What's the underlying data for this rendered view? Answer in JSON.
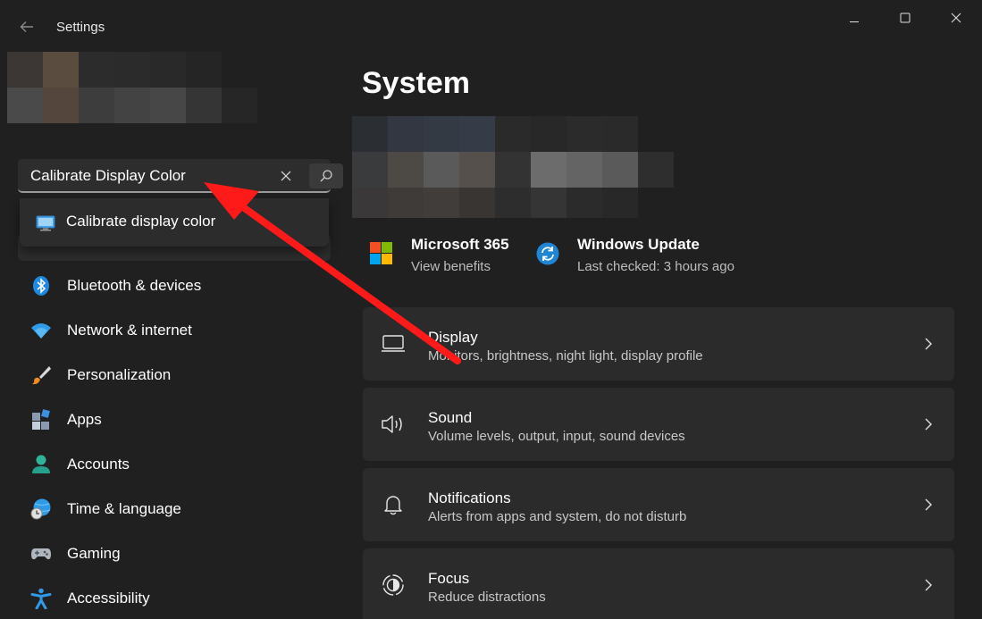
{
  "window": {
    "title": "Settings"
  },
  "search": {
    "value": "Calibrate Display Color",
    "suggestion": "Calibrate display color"
  },
  "sidebar": {
    "items": [
      {
        "label": "Bluetooth & devices",
        "icon": "bluetooth-icon"
      },
      {
        "label": "Network & internet",
        "icon": "wifi-icon"
      },
      {
        "label": "Personalization",
        "icon": "brush-icon"
      },
      {
        "label": "Apps",
        "icon": "apps-icon"
      },
      {
        "label": "Accounts",
        "icon": "person-icon"
      },
      {
        "label": "Time & language",
        "icon": "globe-clock-icon"
      },
      {
        "label": "Gaming",
        "icon": "gamepad-icon"
      },
      {
        "label": "Accessibility",
        "icon": "accessibility-icon"
      }
    ]
  },
  "main": {
    "title": "System",
    "quick_links": [
      {
        "title": "Microsoft 365",
        "subtitle": "View benefits",
        "icon": "microsoft-logo-icon"
      },
      {
        "title": "Windows Update",
        "subtitle": "Last checked: 3 hours ago",
        "icon": "windows-update-icon"
      }
    ],
    "cards": [
      {
        "title": "Display",
        "subtitle": "Monitors, brightness, night light, display profile",
        "icon": "monitor-icon"
      },
      {
        "title": "Sound",
        "subtitle": "Volume levels, output, input, sound devices",
        "icon": "speaker-icon"
      },
      {
        "title": "Notifications",
        "subtitle": "Alerts from apps and system, do not disturb",
        "icon": "bell-icon"
      },
      {
        "title": "Focus",
        "subtitle": "Reduce distractions",
        "icon": "focus-icon"
      }
    ]
  },
  "colors": {
    "background": "#202020",
    "card": "#2b2b2b",
    "annotation_arrow": "#ff1a1a"
  }
}
